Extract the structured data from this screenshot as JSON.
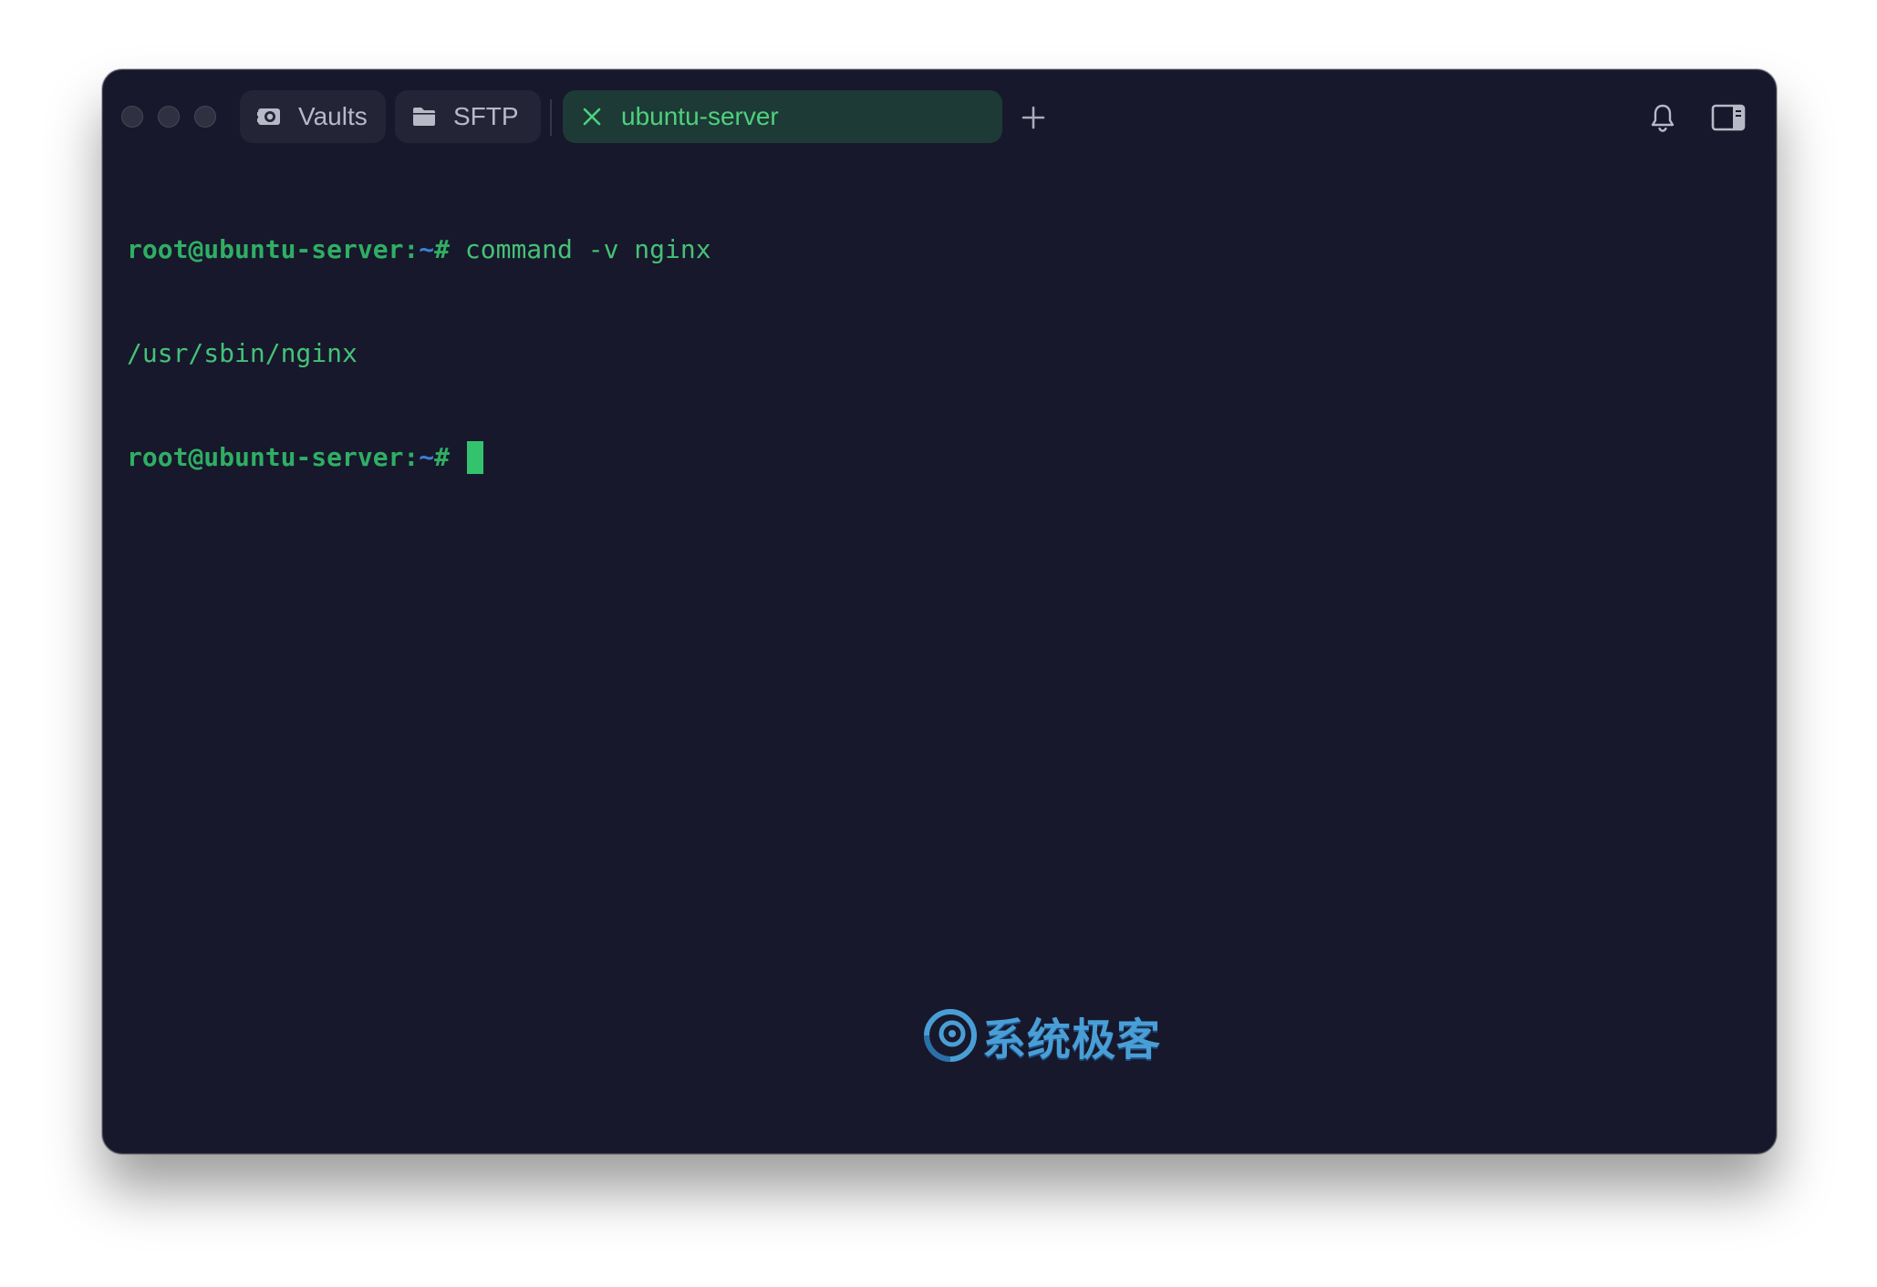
{
  "window": {
    "traffic_lights": [
      "close",
      "minimize",
      "maximize"
    ]
  },
  "tabs": [
    {
      "label": "Vaults",
      "icon": "vault-icon",
      "active": false
    },
    {
      "label": "SFTP",
      "icon": "folder-icon",
      "active": false
    },
    {
      "label": "ubuntu-server",
      "icon": "close-icon",
      "active": true
    }
  ],
  "toolbar": {
    "new_tab_icon": "plus-icon",
    "notifications_icon": "bell-icon",
    "sidebar_icon": "sidebar-toggle-icon"
  },
  "terminal": {
    "lines": [
      {
        "user": "root@ubuntu-server:",
        "tilde": "~",
        "hash": "#",
        "command": " command -v nginx"
      },
      {
        "output": "/usr/sbin/nginx"
      },
      {
        "user": "root@ubuntu-server:",
        "tilde": "~",
        "hash": "#",
        "command": " "
      }
    ]
  },
  "watermark": {
    "text": "系统极客"
  },
  "colors": {
    "background": "#17182b",
    "accent_green": "#3dba6f",
    "tilde_blue": "#3f7fd6",
    "tab_bg": "#232537",
    "active_tab_bg": "#1d3a36"
  }
}
